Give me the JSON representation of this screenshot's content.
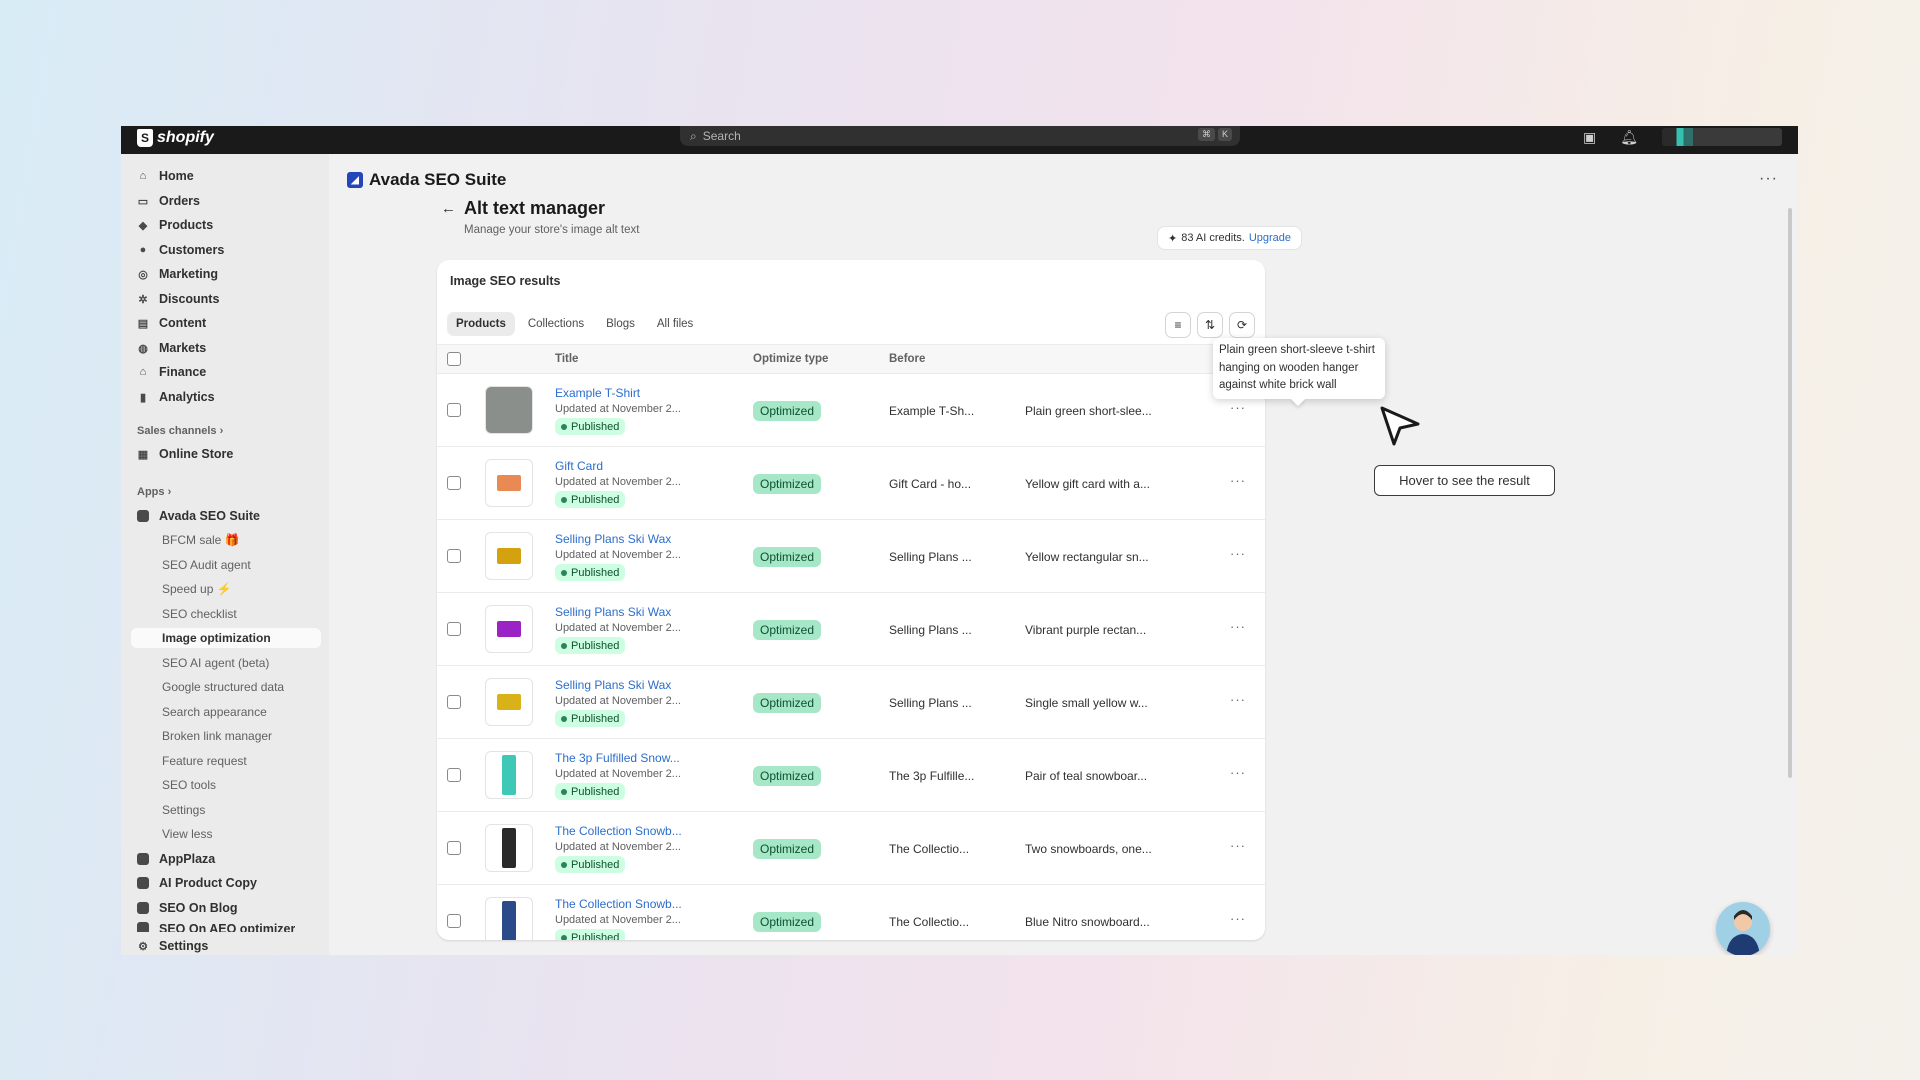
{
  "topbar": {
    "brand": "shopify",
    "search_placeholder": "Search",
    "shortcut_keys": [
      "⌘",
      "K"
    ]
  },
  "sidebar": {
    "main_items": [
      {
        "label": "Home",
        "icon": "home-icon"
      },
      {
        "label": "Orders",
        "icon": "orders-icon"
      },
      {
        "label": "Products",
        "icon": "tag-icon"
      },
      {
        "label": "Customers",
        "icon": "person-icon"
      },
      {
        "label": "Marketing",
        "icon": "target-icon"
      },
      {
        "label": "Discounts",
        "icon": "discount-icon"
      },
      {
        "label": "Content",
        "icon": "content-icon"
      },
      {
        "label": "Markets",
        "icon": "globe-icon"
      },
      {
        "label": "Finance",
        "icon": "bank-icon"
      },
      {
        "label": "Analytics",
        "icon": "chart-icon"
      }
    ],
    "sales_channels_label": "Sales channels",
    "online_store_label": "Online Store",
    "apps_label": "Apps",
    "avada_label": "Avada SEO Suite",
    "avada_sub_items": [
      {
        "label": "BFCM sale 🎁"
      },
      {
        "label": "SEO Audit agent"
      },
      {
        "label": "Speed up ⚡"
      },
      {
        "label": "SEO checklist"
      },
      {
        "label": "Image optimization"
      },
      {
        "label": "SEO AI agent (beta)"
      },
      {
        "label": "Google structured data"
      },
      {
        "label": "Search appearance"
      },
      {
        "label": "Broken link manager"
      },
      {
        "label": "Feature request"
      },
      {
        "label": "SEO tools"
      },
      {
        "label": "Settings"
      },
      {
        "label": "View less"
      }
    ],
    "other_apps": [
      {
        "label": "AppPlaza"
      },
      {
        "label": "AI Product Copy"
      },
      {
        "label": "SEO On Blog"
      },
      {
        "label": "SEO On AEO optimizer"
      }
    ],
    "settings_label": "Settings"
  },
  "main": {
    "app_title": "Avada SEO Suite",
    "page_title": "Alt text manager",
    "page_subtitle": "Manage your store's image alt text",
    "credits_text": "83 AI credits.",
    "upgrade_label": "Upgrade",
    "card_title": "Image SEO results",
    "tabs": [
      {
        "label": "Products"
      },
      {
        "label": "Collections"
      },
      {
        "label": "Blogs"
      },
      {
        "label": "All files"
      }
    ],
    "columns": {
      "title": "Title",
      "optimize_type": "Optimize type",
      "before": "Before"
    },
    "rows": [
      {
        "title": "Example T-Shirt",
        "updated": "Updated at November 2...",
        "status": "Published",
        "optimize": "Optimized",
        "before": "Example T-Sh...",
        "after": "Plain green short-slee...",
        "thumb": "#8a8f8c"
      },
      {
        "title": "Gift Card",
        "updated": "Updated at November 2...",
        "status": "Published",
        "optimize": "Optimized",
        "before": "Gift Card - ho...",
        "after": "Yellow gift card with a...",
        "thumb": "#e98a55"
      },
      {
        "title": "Selling Plans Ski Wax",
        "updated": "Updated at November 2...",
        "status": "Published",
        "optimize": "Optimized",
        "before": "Selling Plans ...",
        "after": "Yellow rectangular sn...",
        "thumb": "#d4a20f"
      },
      {
        "title": "Selling Plans Ski Wax",
        "updated": "Updated at November 2...",
        "status": "Published",
        "optimize": "Optimized",
        "before": "Selling Plans ...",
        "after": "Vibrant purple rectan...",
        "thumb": "#9b22c4"
      },
      {
        "title": "Selling Plans Ski Wax",
        "updated": "Updated at November 2...",
        "status": "Published",
        "optimize": "Optimized",
        "before": "Selling Plans ...",
        "after": "Single small yellow w...",
        "thumb": "#d9b21a"
      },
      {
        "title": "The 3p Fulfilled Snow...",
        "updated": "Updated at November 2...",
        "status": "Published",
        "optimize": "Optimized",
        "before": "The 3p Fulfille...",
        "after": "Pair of teal snowboar...",
        "thumb": "#3ec9b7"
      },
      {
        "title": "The Collection Snowb...",
        "updated": "Updated at November 2...",
        "status": "Published",
        "optimize": "Optimized",
        "before": "The Collectio...",
        "after": "Two snowboards, one...",
        "thumb": "#2a2a2a"
      },
      {
        "title": "The Collection Snowb...",
        "updated": "Updated at November 2...",
        "status": "Published",
        "optimize": "Optimized",
        "before": "The Collectio...",
        "after": "Blue Nitro snowboard...",
        "thumb": "#2b4a8a"
      }
    ],
    "tooltip_text": "Plain green short-sleeve t-shirt hanging on wooden hanger against white brick wall",
    "hover_callout": "Hover to see the result"
  }
}
